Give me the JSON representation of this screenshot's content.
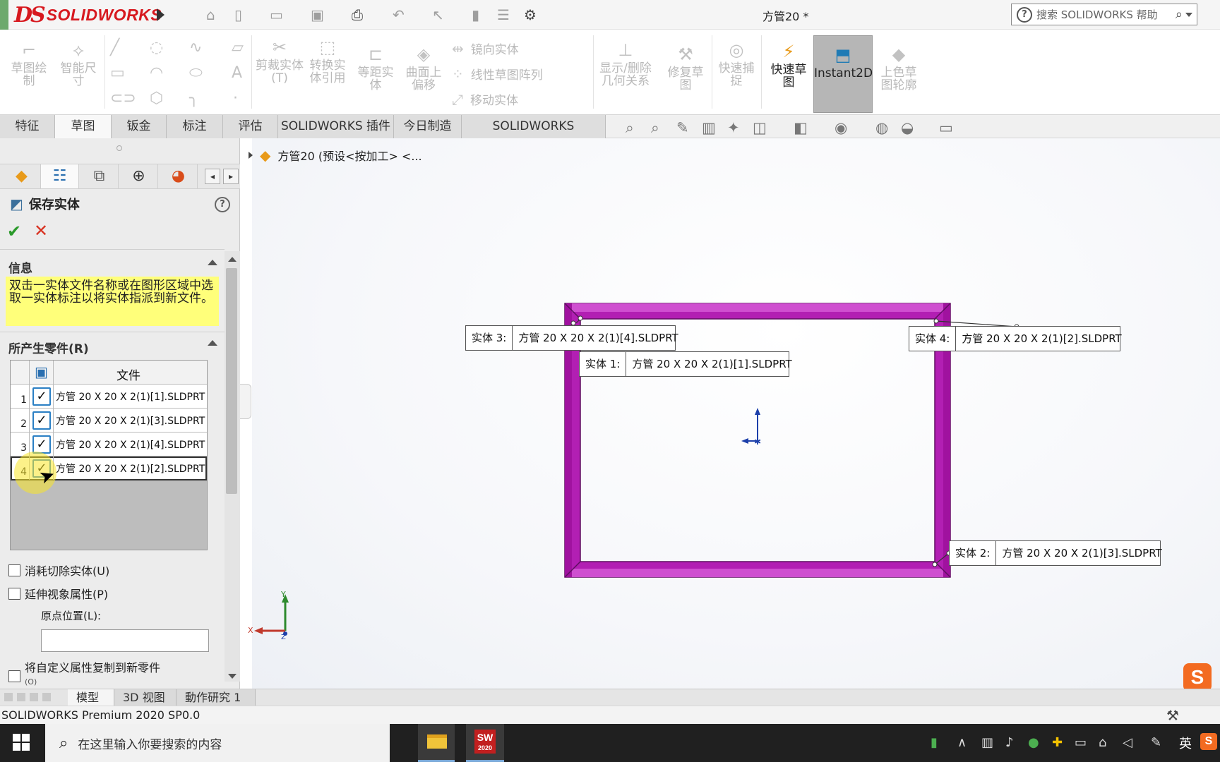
{
  "app": {
    "brand_ds": "DS",
    "brand_name": "SOLIDWORKS",
    "doc_title": "方管20 *",
    "help_search_placeholder": "搜索 SOLIDWORKS 帮助"
  },
  "quick_access": [
    "home-icon",
    "new-icon",
    "open-icon",
    "save-icon",
    "print-icon",
    "undo-icon",
    "select-icon",
    "rebuild-icon",
    "file-properties-icon",
    "options-icon"
  ],
  "command_manager": {
    "sketch_draw": "草图绘制",
    "smart_dimension": "智能尺寸",
    "trim": "剪裁实体(T)",
    "convert": "转换实体引用",
    "offset": "等距实体",
    "surface_offset": "曲面上偏移",
    "mirror": "镜向实体",
    "linear_pattern": "线性草图阵列",
    "move": "移动实体",
    "display_delete_relations": "显示/删除几何关系",
    "repair_sketch": "修复草图",
    "quick_snaps": "快速捕捉",
    "rapid_sketch": "快速草图",
    "instant2d": "Instant2D",
    "shaded_sketch": "上色草图轮廓"
  },
  "tabs": [
    {
      "label": "特征"
    },
    {
      "label": "草图"
    },
    {
      "label": "钣金"
    },
    {
      "label": "标注"
    },
    {
      "label": "评估"
    },
    {
      "label": "SOLIDWORKS 插件"
    },
    {
      "label": "今日制造"
    },
    {
      "label": "SOLIDWORKS Inspection"
    }
  ],
  "active_tab_index": 1,
  "property_manager": {
    "title": "保存实体",
    "info_header": "信息",
    "info_message": "双击一实体文件名称或在图形区域中选取一实体标注以将实体指派到新文件。",
    "parts_header": "所产生零件(R)",
    "table_header_file": "文件",
    "rows": [
      {
        "num": "1",
        "checked": true,
        "file": "方管 20 X 20 X 2(1)[1].SLDPRT"
      },
      {
        "num": "2",
        "checked": true,
        "file": "方管 20 X 20 X 2(1)[3].SLDPRT"
      },
      {
        "num": "3",
        "checked": true,
        "file": "方管 20 X 20 X 2(1)[4].SLDPRT"
      },
      {
        "num": "4",
        "checked": true,
        "file": "方管 20 X 20 X 2(1)[2].SLDPRT"
      }
    ],
    "opt_consume": "消耗切除实体(U)",
    "opt_propagate": "延伸视象属性(P)",
    "origin_label": "原点位置(L):",
    "origin_value": "",
    "opt_copy_props": "将自定义属性复制到新零件",
    "opt_copy_props_key": "(O)"
  },
  "feature_tree_node": "方管20  (预设<按加工> <...",
  "callouts": [
    {
      "label": "实体 3:",
      "file": "方管 20 X 20 X 2(1)[4].SLDPRT"
    },
    {
      "label": "实体 1:",
      "file": "方管 20 X 20 X 2(1)[1].SLDPRT"
    },
    {
      "label": "实体 4:",
      "file": "方管 20 X 20 X 2(1)[2].SLDPRT"
    },
    {
      "label": "实体 2:",
      "file": "方管 20 X 20 X 2(1)[3].SLDPRT"
    }
  ],
  "triad": {
    "x": "X",
    "y": "Y",
    "z": "Z"
  },
  "bottom_tabs": [
    {
      "label": "模型"
    },
    {
      "label": "3D 视图"
    },
    {
      "label": "動作研究 1"
    }
  ],
  "status_text": "SOLIDWORKS Premium 2020 SP0.0",
  "taskbar": {
    "search_placeholder": "在这里输入你要搜索的内容",
    "sw_badge": "SW",
    "sw_year": "2020",
    "ime_lang": "英",
    "sogou": "S"
  },
  "colors": {
    "frame": "#b21fb3",
    "frame_light": "#d64fd7",
    "accent_red": "#d7191f",
    "info_yellow": "#ffff7a"
  }
}
